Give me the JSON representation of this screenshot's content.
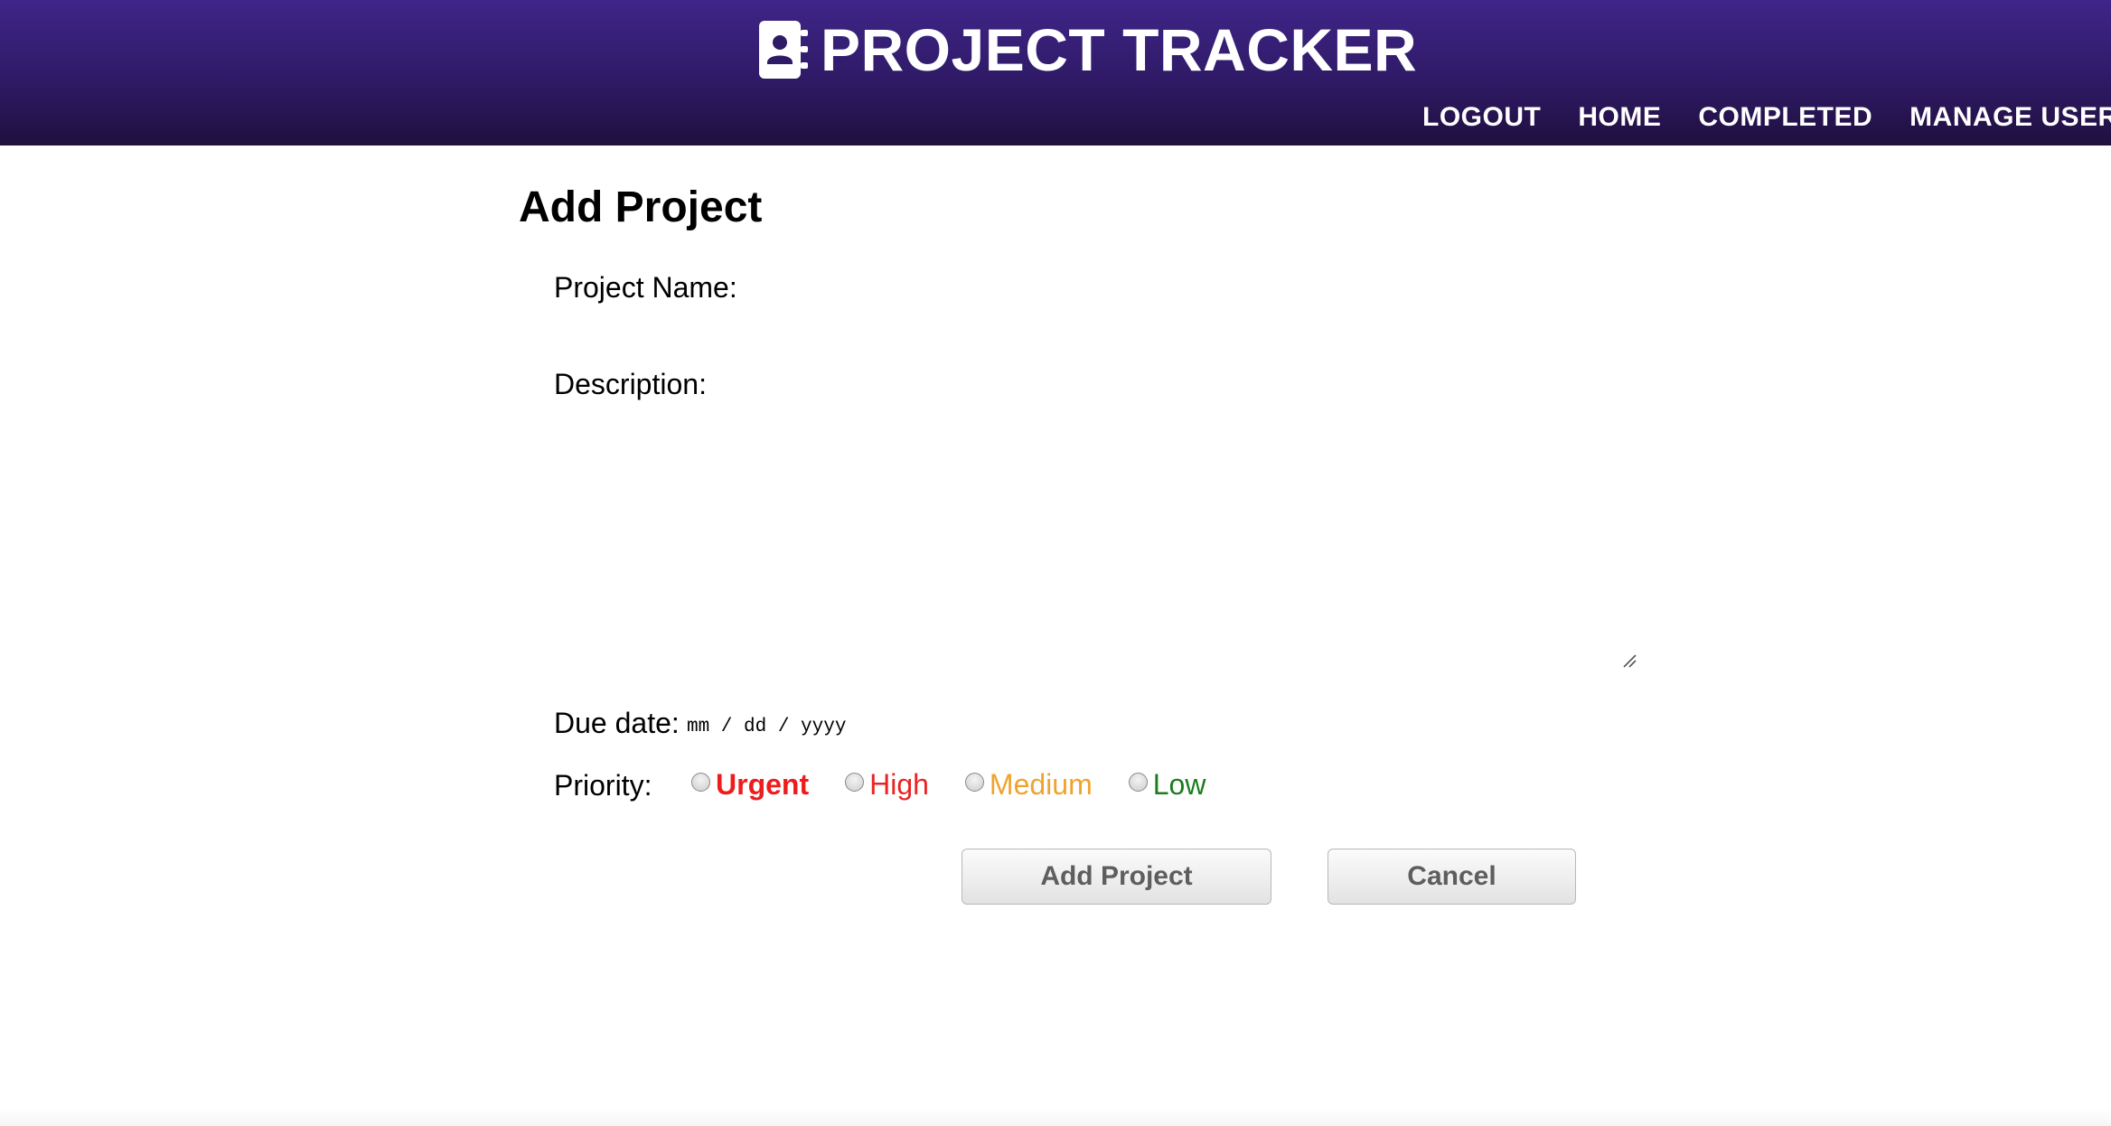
{
  "header": {
    "title": "PROJECT TRACKER",
    "brand_icon": "contact-book-icon",
    "nav": [
      {
        "label": "LOGOUT"
      },
      {
        "label": "HOME"
      },
      {
        "label": "COMPLETED"
      },
      {
        "label": "MANAGE USERS"
      }
    ]
  },
  "main": {
    "title": "Add Project",
    "form": {
      "project_name_label": "Project Name:",
      "project_name_value": "",
      "description_label": "Description:",
      "description_value": "",
      "due_date_label": "Due date:",
      "due_date_placeholder": "mm / dd / yyyy",
      "priority_label": "Priority:",
      "priority_options": [
        {
          "label": "Urgent",
          "color": "#ee1c1c",
          "checked": false
        },
        {
          "label": "High",
          "color": "#e82424",
          "checked": false
        },
        {
          "label": "Medium",
          "color": "#f0a32c",
          "checked": false
        },
        {
          "label": "Low",
          "color": "#1c7d1c",
          "checked": false
        }
      ],
      "submit_label": "Add Project",
      "cancel_label": "Cancel"
    }
  },
  "colors": {
    "header_gradient_top": "#3f2589",
    "header_gradient_bottom": "#200f3e",
    "nav_text": "#ffffff",
    "button_text": "#5e5e5e"
  }
}
